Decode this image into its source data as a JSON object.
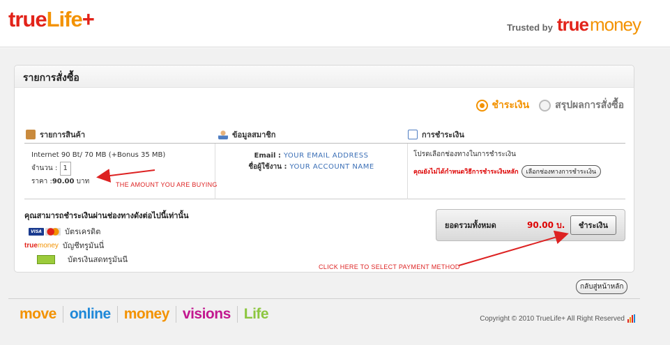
{
  "header": {
    "logo": {
      "part1": "true",
      "part2": "Life",
      "part3": "+"
    },
    "trusted_label": "Trusted by",
    "truemoney_part1": "true",
    "truemoney_part2": "money"
  },
  "panel": {
    "title": "รายการสั่งซื้อ",
    "steps": [
      {
        "label": "ชำระเงิน",
        "active": true
      },
      {
        "label": "สรุปผลการสั่งซื้อ",
        "active": false
      }
    ],
    "columns": [
      {
        "label": "รายการสินค้า",
        "icon": "package-icon"
      },
      {
        "label": "ข้อมูลสมาชิก",
        "icon": "user-icon"
      },
      {
        "label": "การชำระเงิน",
        "icon": "document-icon"
      }
    ],
    "product": {
      "name": "Internet 90 Bt/ 70 MB (+Bonus 35 MB)",
      "qty_label": "จำนวน :",
      "qty": "1",
      "price_label": "ราคา :",
      "price": "90.00",
      "currency": "บาท"
    },
    "member": {
      "email_label": "Email :",
      "email_value": "YOUR EMAIL ADDRESS",
      "user_label": "ชื่อผู้ใช้งาน :",
      "user_value": "YOUR ACCOUNT NAME"
    },
    "payment": {
      "prompt": "โปรดเลือกช่องทางในการชำระเงิน",
      "warning": "คุณยังไม่ได้กำหนดวิธีการชำระเงินหลัก",
      "choose_button": "เลือกช่องทางการชำระเงิน"
    },
    "methods": {
      "title": "คุณสามารถชำระเงินผ่านช่องทางดังต่อไปนี้เท่านั้น",
      "items": [
        {
          "label": "บัตรเครดิต",
          "icon": "credit-card-icon"
        },
        {
          "label": "บัญชีทรูมันนี่",
          "icon": "truemoney-logo-icon"
        },
        {
          "label": "บัตรเงินสดทรูมันนี",
          "icon": "cash-card-icon"
        }
      ],
      "visa_text": "VISA",
      "tm_part1": "true",
      "tm_part2": "money"
    },
    "total": {
      "label": "ยอดรวมทั้งหมด",
      "amount": "90.00 บ.",
      "pay_button": "ชำระเงิน"
    }
  },
  "annotations": {
    "amount": "THE AMOUNT YOU ARE BUYING",
    "payment": "CLICK HERE TO SELECT PAYMENT METHOD",
    "color": "#dd2222"
  },
  "back_button": "กลับสู่หน้าหลัก",
  "footer": {
    "brands": [
      {
        "label": "move",
        "color": "#f39200"
      },
      {
        "label": "online",
        "color": "#1e88d8"
      },
      {
        "label": "money",
        "color": "#f39200"
      },
      {
        "label": "visions",
        "color": "#c2188f"
      },
      {
        "label": "Life",
        "color": "#8cc63f"
      }
    ],
    "copyright": "Copyright © 2010 TrueLife+ All Right Reserved"
  },
  "colors": {
    "brand_red": "#e2231a",
    "brand_orange": "#f39200",
    "link_blue": "#3b6fb6"
  }
}
